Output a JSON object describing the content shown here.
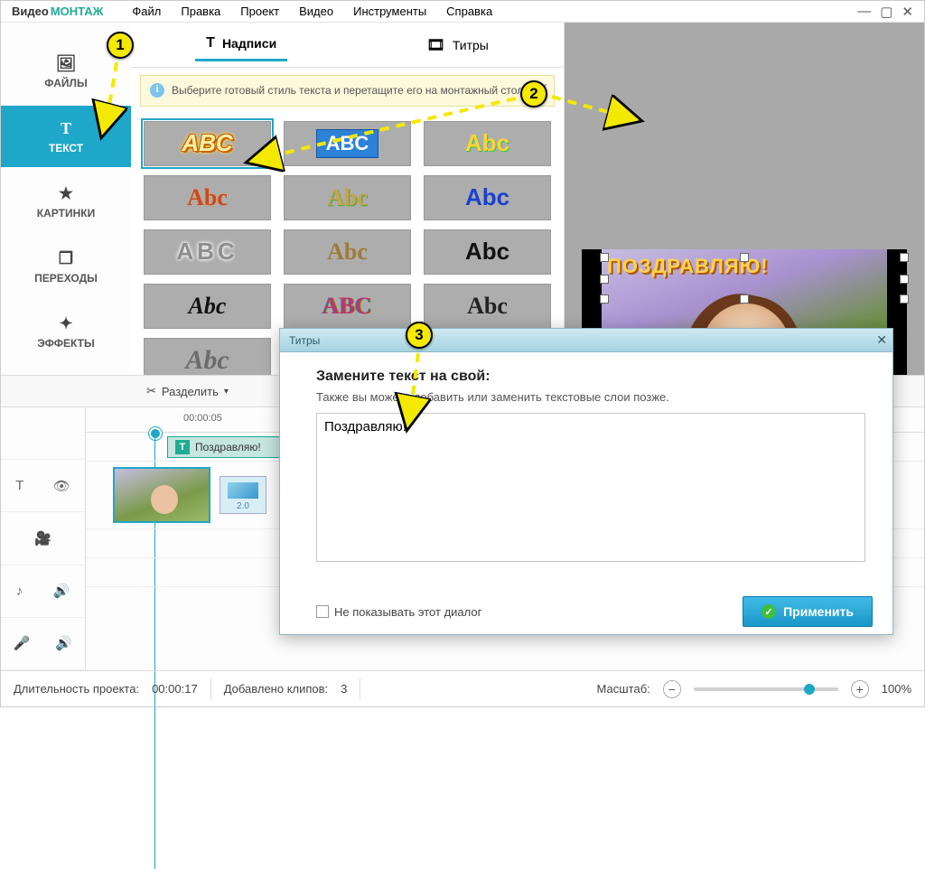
{
  "app": {
    "logo_pre": "Видео",
    "logo_post": "МОНТАЖ"
  },
  "menu": {
    "file": "Файл",
    "edit": "Правка",
    "project": "Проект",
    "video": "Видео",
    "tools": "Инструменты",
    "help": "Справка"
  },
  "sidebar": {
    "files": "ФАЙЛЫ",
    "text": "ТЕКСТ",
    "pictures": "КАРТИНКИ",
    "transitions": "ПЕРЕХОДЫ",
    "effects": "ЭФФЕКТЫ"
  },
  "tabs": {
    "captions": "Надписи",
    "titles": "Титры"
  },
  "info_banner": "Выберите готовый стиль текста и перетащите его на монтажный стол.",
  "styles": [
    {
      "id": "s1",
      "sample": "ABC",
      "css": "font-style:italic;color:#fff1a8;text-shadow:2px 2px 0 #c86400,-1px -1px 0 #c86400,1px -1px 0 #c86400,-1px 1px 0 #c86400;filter:drop-shadow(0 0 2px #ffd24a)"
    },
    {
      "id": "s2",
      "sample": "ABC",
      "css": "color:#fff;background:#2b82d7;padding:2px 10px;font-family:sans-serif;font-size:22px;border:1px solid #1855a1"
    },
    {
      "id": "s3",
      "sample": "Abc",
      "css": "color:#ffd33a;text-shadow:1px 1px 0 #2c4;font-weight:bold"
    },
    {
      "id": "s4",
      "sample": "Abc",
      "css": "color:#c74a20;font-family:Georgia,serif;text-shadow:0 0 2px #e2a06a"
    },
    {
      "id": "s5",
      "sample": "Abc",
      "css": "color:#caa24d;font-family:Georgia,serif;text-shadow:1px 1px 1px #4a2"
    },
    {
      "id": "s6",
      "sample": "Abc",
      "css": "color:#1b42cf;font-family:Arial;font-weight:bold"
    },
    {
      "id": "s7",
      "sample": "ABC",
      "css": "color:#8e8e8e;font-family:Arial;font-weight:bold;letter-spacing:4px;text-shadow:0 0 3px #fff,0 0 5px #fff"
    },
    {
      "id": "s8",
      "sample": "Abc",
      "css": "color:#a07a3a;font-family:Georgia,serif"
    },
    {
      "id": "s9",
      "sample": "Abc",
      "css": "color:#111;font-family:Arial;font-weight:bold"
    },
    {
      "id": "s10",
      "sample": "Abc",
      "css": "color:#111;font-style:italic;font-family:Georgia,serif;font-weight:bold"
    },
    {
      "id": "s11",
      "sample": "ABC",
      "css": "color:#c33366;font-family:Georgia,serif;font-weight:bold;text-shadow:1px 0 #7b2,-1px 0 #36c"
    },
    {
      "id": "s12",
      "sample": "Abc",
      "css": "color:#222;font-family:Georgia,serif"
    },
    {
      "id": "s13",
      "sample": "Abc",
      "css": "color:#6b6b6b;font-family:'Brush Script MT',cursive;font-style:italic;font-size:30px"
    }
  ],
  "preview": {
    "overlay_text": "ПОЗДРАВЛЯЮ!"
  },
  "toolbar": {
    "split": "Разделить"
  },
  "ruler": {
    "t0": "00:00:05"
  },
  "textclip": {
    "label": "Поздравляю!"
  },
  "transition": {
    "label": "2.0"
  },
  "dialog": {
    "title": "Титры",
    "heading": "Замените текст на свой:",
    "hint": "Также вы можете добавить или заменить текстовые слои позже.",
    "textarea_value": "Поздравляю!",
    "dont_show": "Не показывать этот диалог",
    "apply": "Применить"
  },
  "status": {
    "duration_label": "Длительность проекта:",
    "duration_value": "00:00:17",
    "clips_label": "Добавлено клипов:",
    "clips_value": "3",
    "zoom_label": "Масштаб:",
    "zoom_value": "100%"
  },
  "markers": {
    "m1": "1",
    "m2": "2",
    "m3": "3"
  }
}
